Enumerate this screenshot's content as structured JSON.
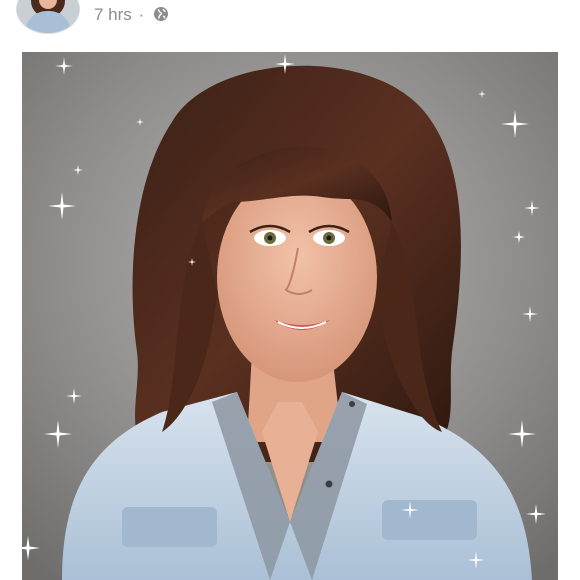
{
  "post": {
    "timestamp": "7 hrs",
    "separator": "·",
    "audience_icon": "globe-icon",
    "photo_subject": "portrait",
    "sparkle_color": "#ffffff"
  },
  "colors": {
    "meta_text": "#8a8d91",
    "photo_background": "#8d8c8a"
  }
}
